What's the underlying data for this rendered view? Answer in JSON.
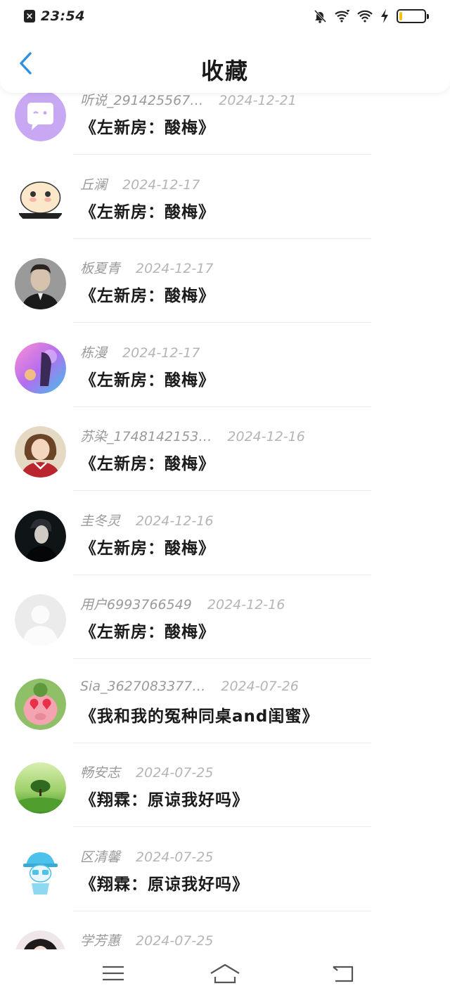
{
  "status_bar": {
    "time": "23:54",
    "app_badge": "×",
    "battery_level": 0.12
  },
  "header": {
    "title": "收藏",
    "back_icon": "chevron-left-icon"
  },
  "favorites": [
    {
      "user": "听说_291425567…",
      "date": "2024-12-21",
      "work": "《左新房：酸梅》",
      "avatar": "speech-bubble"
    },
    {
      "user": "丘澜",
      "date": "2024-12-17",
      "work": "《左新房：酸梅》",
      "avatar": "cartoon"
    },
    {
      "user": "板夏青",
      "date": "2024-12-17",
      "work": "《左新房：酸梅》",
      "avatar": "photo-dark"
    },
    {
      "user": "栋漫",
      "date": "2024-12-17",
      "work": "《左新房：酸梅》",
      "avatar": "photo-colorful"
    },
    {
      "user": "苏染_1748142153…",
      "date": "2024-12-16",
      "work": "《左新房：酸梅》",
      "avatar": "photo-girl"
    },
    {
      "user": "圭冬灵",
      "date": "2024-12-16",
      "work": "《左新房：酸梅》",
      "avatar": "photo-dark2"
    },
    {
      "user": "用户6993766549",
      "date": "2024-12-16",
      "work": "《左新房：酸梅》",
      "avatar": "default"
    },
    {
      "user": "Sia_3627083377…",
      "date": "2024-07-26",
      "work": "《我和我的冤种同桌and闺蜜》",
      "avatar": "pig"
    },
    {
      "user": "畅安志",
      "date": "2024-07-25",
      "work": "《翔霖：原谅我好吗》",
      "avatar": "tree"
    },
    {
      "user": "区清馨",
      "date": "2024-07-25",
      "work": "《翔霖：原谅我好吗》",
      "avatar": "cartoon-blue"
    },
    {
      "user": "学芳蕙",
      "date": "2024-07-25",
      "work": "",
      "avatar": "photo-girl2"
    }
  ],
  "nav_bar": {
    "menu_icon": "menu-icon",
    "home_icon": "home-icon",
    "back_icon": "back-icon"
  },
  "colors": {
    "accent": "#2f8fe0",
    "meta_text": "#9a9a9a",
    "divider": "#ececec"
  }
}
